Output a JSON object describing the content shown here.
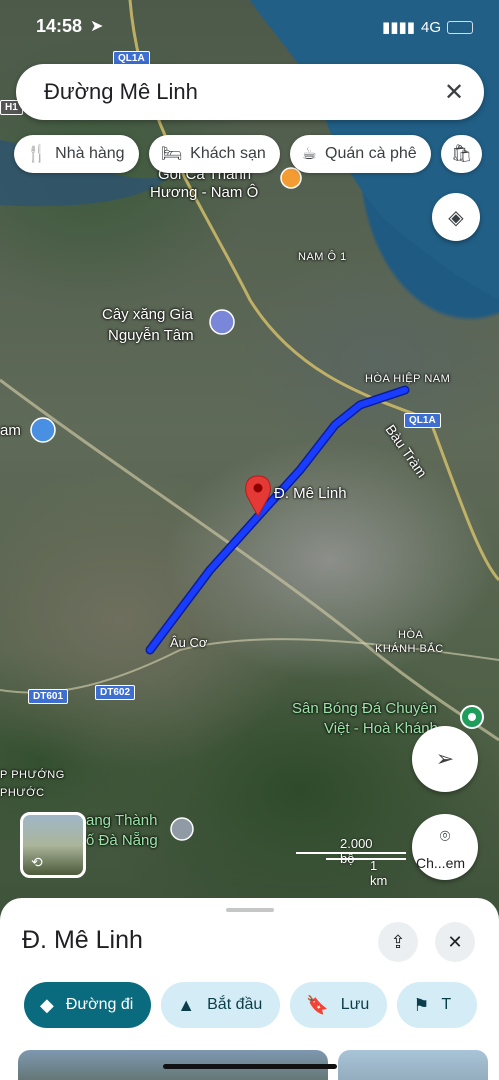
{
  "status_bar": {
    "time": "14:58",
    "network": "4G"
  },
  "search": {
    "query": "Đường Mê Linh"
  },
  "chips": [
    {
      "label": "Nhà hàng",
      "icon": "restaurant-icon"
    },
    {
      "label": "Khách sạn",
      "icon": "hotel-icon"
    },
    {
      "label": "Quán cà phê",
      "icon": "coffee-icon"
    }
  ],
  "map": {
    "pin_label": "Đ. Mê Linh",
    "labels": {
      "ql1a_top": "QL1A",
      "ql1a_right": "QL1A",
      "h1": "H1",
      "poi_restaurant_line1": "Gỏi Cá Thành",
      "poi_restaurant_line2": "Hương - Nam Ô",
      "nam_o": "NAM Ô 1",
      "gas_line1": "Cây xăng Gia",
      "gas_line2": "Nguyễn Tâm",
      "hoa_hiep": "HÒA HIỆP NAM",
      "bau_tram": "Bàu Tràm",
      "am": "am",
      "au_co": "Âu Cơ",
      "hoa_khanh_line1": "HÒA",
      "hoa_khanh_line2": "KHÁNH BẮC",
      "san_bong_line1": "Sân Bóng Đá Chuyên",
      "san_bong_line2": "Việt - Hoà Khánh",
      "dt601": "DT601",
      "dt602": "DT602",
      "phuong_line1": "P PHƯỚNG",
      "phuong_line2": "PHƯỚC",
      "lang_line1": "ang Thành",
      "lang_line2": "ố Đà Nẵng",
      "scale_top": "2.000 bộ",
      "scale_bottom": "1 km",
      "camera_label": "Ch...em"
    }
  },
  "sheet": {
    "title": "Đ. Mê Linh",
    "actions": [
      {
        "label": "Đường đi",
        "icon": "directions-icon"
      },
      {
        "label": "Bắt đầu",
        "icon": "navigation-icon"
      },
      {
        "label": "Lưu",
        "icon": "bookmark-icon"
      },
      {
        "label": "T",
        "icon": "flag-icon"
      }
    ]
  },
  "colors": {
    "route": "#1a3cff",
    "pin": "#e53935",
    "primary_action": "#0b6b7e",
    "secondary_action": "#d3ecf5"
  }
}
